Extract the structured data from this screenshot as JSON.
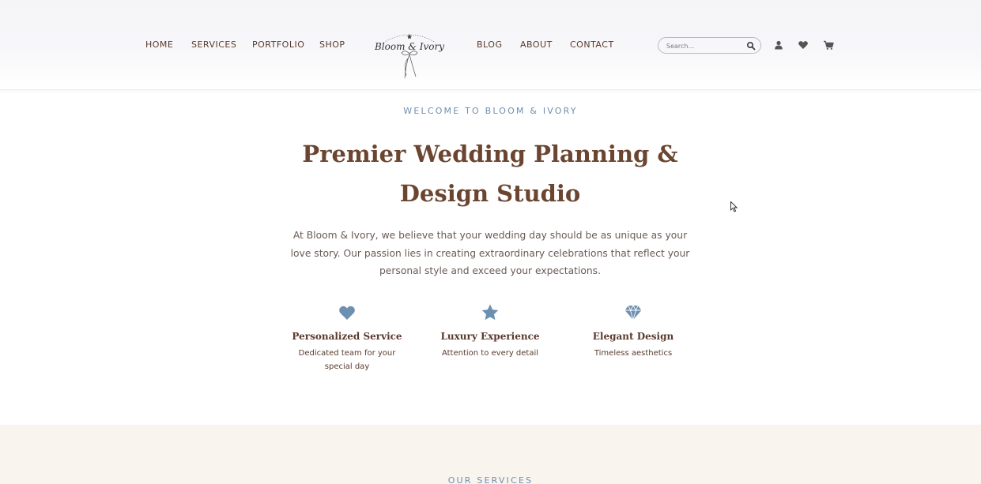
{
  "nav": {
    "left": [
      "HOME",
      "SERVICES",
      "PORTFOLIO",
      "SHOP"
    ],
    "right": [
      "BLOG",
      "ABOUT",
      "CONTACT"
    ]
  },
  "logo": {
    "text": "Bloom & Ivory"
  },
  "search": {
    "placeholder": "Search...",
    "icon": "search-icon"
  },
  "header_icons": [
    "user-icon",
    "heart-icon",
    "cart-icon"
  ],
  "hero": {
    "eyebrow": "WELCOME TO BLOOM & IVORY",
    "title_line1": "Premier Wedding Planning &",
    "title_line2": "Design Studio",
    "intro": "At Bloom & Ivory, we believe that your wedding day should be as unique as your love story. Our passion lies in creating extraordinary celebrations that reflect your personal style and exceed your expectations."
  },
  "features": [
    {
      "icon": "heart-icon",
      "title": "Personalized Service",
      "desc": "Dedicated team for your special day"
    },
    {
      "icon": "star-icon",
      "title": "Luxury Experience",
      "desc": "Attention to every detail"
    },
    {
      "icon": "diamond-icon",
      "title": "Elegant Design",
      "desc": "Timeless aesthetics"
    }
  ],
  "services": {
    "label": "OUR SERVICES"
  },
  "colors": {
    "brown": "#6b4530",
    "accent_blue": "#6d8fb0",
    "band": "#faf4ef"
  }
}
